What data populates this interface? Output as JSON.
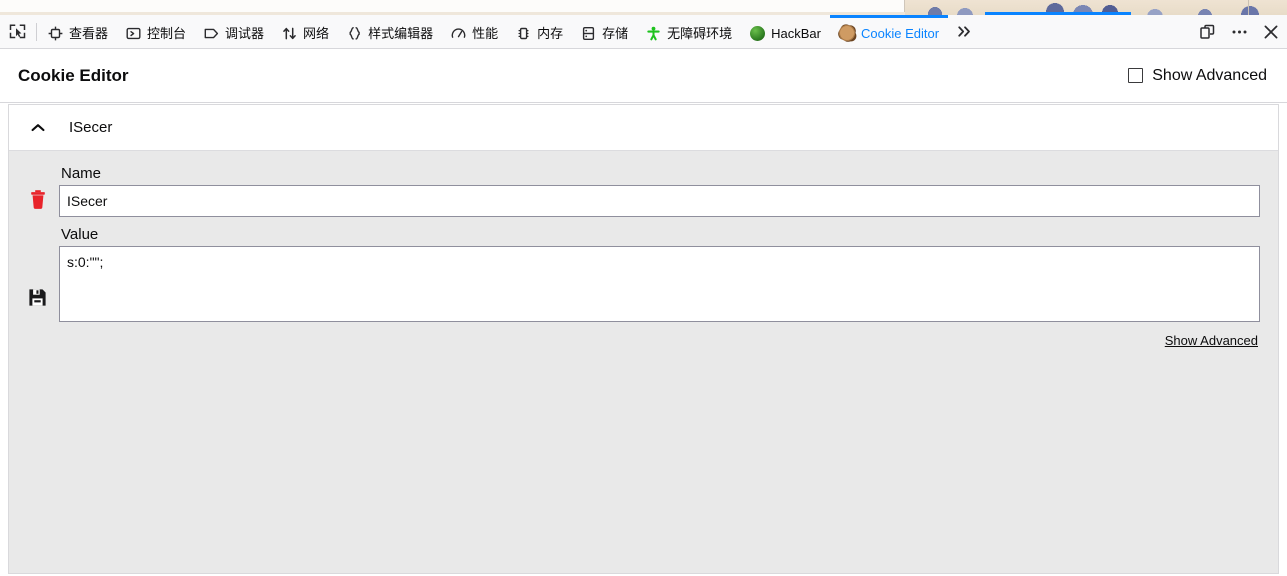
{
  "devtools": {
    "pick_element_icon": "element-picker-icon",
    "tabs": [
      {
        "label": "查看器",
        "icon": "inspector-icon",
        "active": false
      },
      {
        "label": "控制台",
        "icon": "console-icon",
        "active": false
      },
      {
        "label": "调试器",
        "icon": "debugger-icon",
        "active": false
      },
      {
        "label": "网络",
        "icon": "network-icon",
        "active": false
      },
      {
        "label": "样式编辑器",
        "icon": "style-editor-icon",
        "active": false
      },
      {
        "label": "性能",
        "icon": "performance-icon",
        "active": false
      },
      {
        "label": "内存",
        "icon": "memory-icon",
        "active": false
      },
      {
        "label": "存储",
        "icon": "storage-icon",
        "active": false
      },
      {
        "label": "无障碍环境",
        "icon": "accessibility-icon",
        "active": false
      },
      {
        "label": "HackBar",
        "icon": "hackbar-icon",
        "active": false
      },
      {
        "label": "Cookie Editor",
        "icon": "cookie-icon",
        "active": true
      }
    ],
    "controls": {
      "overflow_label": "»",
      "dock_icon": "dock-window-icon",
      "meatball_icon": "more-options-icon",
      "close_icon": "close-icon"
    },
    "active_tab_color": "#0a84ff"
  },
  "panel": {
    "title": "Cookie Editor",
    "show_advanced_top": "Show Advanced",
    "show_advanced_checked": false,
    "cookie": {
      "display_name": "ISecer",
      "expanded": true,
      "name_label": "Name",
      "name_value": "ISecer",
      "value_label": "Value",
      "value_value": "s:0:\"\";",
      "delete_icon": "trash-icon",
      "save_icon": "save-floppy-icon",
      "show_advanced_link": "Show Advanced"
    }
  }
}
